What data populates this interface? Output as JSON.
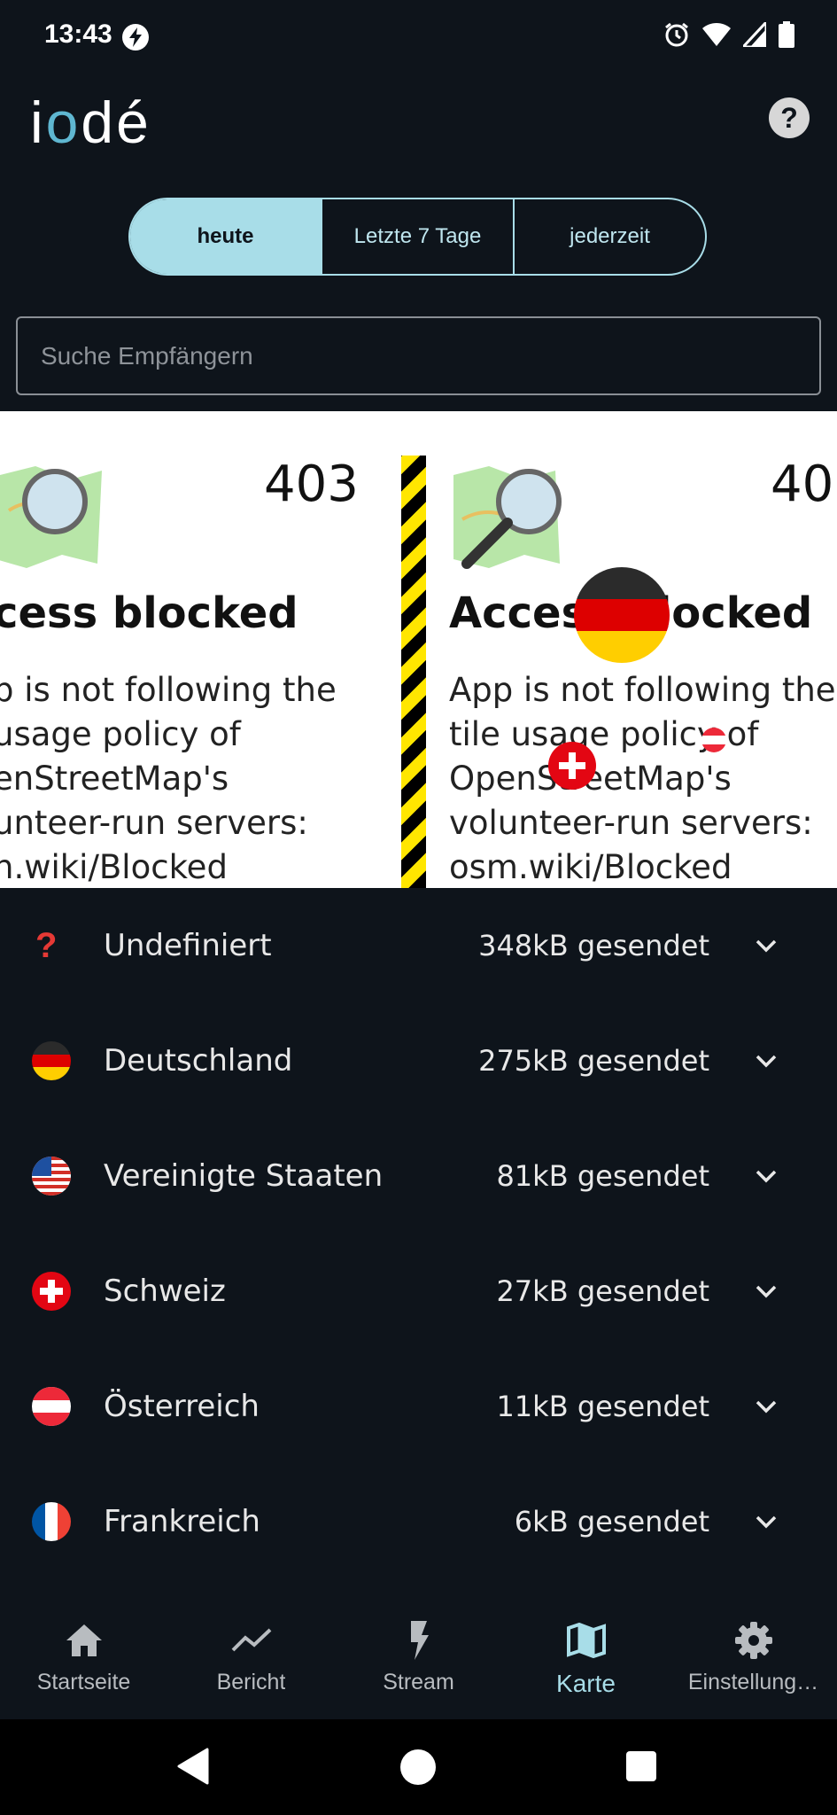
{
  "status_bar": {
    "time": "13:43",
    "left_icons": [
      "charging-bolt-icon"
    ],
    "right_icons": [
      "alarm-icon",
      "wifi-icon",
      "signal-icon",
      "battery-icon"
    ]
  },
  "header": {
    "logo": "iodé",
    "help_icon": "question-mark-circle-icon"
  },
  "segments": [
    {
      "label": "heute",
      "selected": true
    },
    {
      "label": "Letzte 7 Tage",
      "selected": false
    },
    {
      "label": "jederzeit",
      "selected": false
    }
  ],
  "search": {
    "placeholder": "Suche Empfängern",
    "value": ""
  },
  "map": {
    "tiles": [
      {
        "code": "403",
        "title": "cess blocked",
        "text": "p is not following the\nusage policy of\nenStreetMap's\nunteer-run servers:\nn.wiki/Blocked"
      },
      {
        "code": "40",
        "title": "Access blocked",
        "text": "App is not following the\ntile usage policy of\nOpenStreetMap's\nvolunteer-run servers:\nosm.wiki/Blocked"
      }
    ],
    "markers": [
      "germany-flag-marker",
      "switzerland-flag-marker",
      "austria-flag-marker"
    ]
  },
  "countries": [
    {
      "flag": "question-icon",
      "name": "Undefiniert",
      "sent": "348kB gesendet"
    },
    {
      "flag": "germany-flag-icon",
      "name": "Deutschland",
      "sent": "275kB gesendet"
    },
    {
      "flag": "usa-flag-icon",
      "name": "Vereinigte Staaten",
      "sent": "81kB gesendet"
    },
    {
      "flag": "switzerland-flag-icon",
      "name": "Schweiz",
      "sent": "27kB gesendet"
    },
    {
      "flag": "austria-flag-icon",
      "name": "Österreich",
      "sent": "11kB gesendet"
    },
    {
      "flag": "france-flag-icon",
      "name": "Frankreich",
      "sent": "6kB gesendet"
    }
  ],
  "bottom_nav": [
    {
      "label": "Startseite",
      "icon": "home-icon",
      "active": false
    },
    {
      "label": "Bericht",
      "icon": "trending-line-icon",
      "active": false
    },
    {
      "label": "Stream",
      "icon": "bolt-icon",
      "active": false
    },
    {
      "label": "Karte",
      "icon": "map-icon",
      "active": true
    },
    {
      "label": "Einstellung…",
      "icon": "gear-icon",
      "active": false
    }
  ],
  "colors": {
    "background": "#0e141b",
    "accent": "#a8dde8",
    "text": "#e8e8e8"
  }
}
